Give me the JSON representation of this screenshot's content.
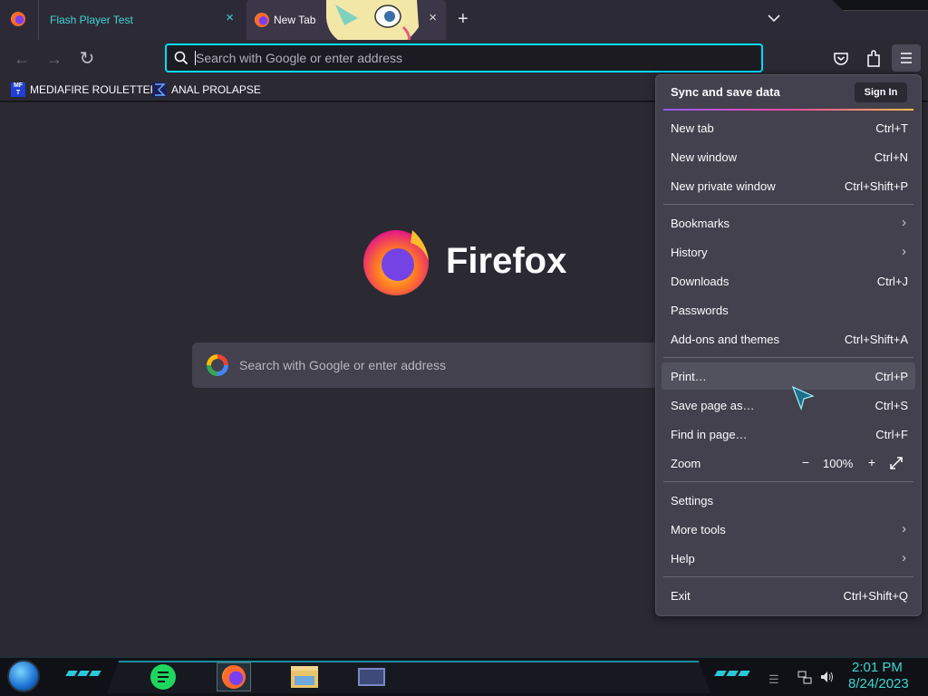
{
  "tabs": [
    {
      "label": "Flash Player Test",
      "close": "×",
      "active": false
    },
    {
      "label": "New Tab",
      "close": "×",
      "active": true
    }
  ],
  "tab_actions": {
    "new_tab": "+",
    "list_all": "chevron-down-icon"
  },
  "navbar": {
    "back": "←",
    "forward": "→",
    "reload": "↻",
    "url_placeholder": "Search with Google or enter address"
  },
  "bookmarks": [
    {
      "label": "MEDIAFIRE ROULETTER",
      "favicon": "MF T"
    },
    {
      "label": "ANAL PROLAPSE",
      "favicon": "sigma"
    }
  ],
  "newtab": {
    "brand": "Firefox",
    "search_placeholder": "Search with Google or enter address"
  },
  "menu": {
    "sync_title": "Sync and save data",
    "sign_in": "Sign In",
    "groups": [
      [
        {
          "label": "New tab",
          "shortcut": "Ctrl+T"
        },
        {
          "label": "New window",
          "shortcut": "Ctrl+N"
        },
        {
          "label": "New private window",
          "shortcut": "Ctrl+Shift+P"
        }
      ],
      [
        {
          "label": "Bookmarks",
          "submenu": true
        },
        {
          "label": "History",
          "submenu": true
        },
        {
          "label": "Downloads",
          "shortcut": "Ctrl+J"
        },
        {
          "label": "Passwords",
          "shortcut": ""
        },
        {
          "label": "Add-ons and themes",
          "shortcut": "Ctrl+Shift+A"
        }
      ],
      [
        {
          "label": "Print…",
          "shortcut": "Ctrl+P",
          "hover": true
        },
        {
          "label": "Save page as…",
          "shortcut": "Ctrl+S"
        },
        {
          "label": "Find in page…",
          "shortcut": "Ctrl+F"
        }
      ],
      [
        {
          "label": "Settings"
        },
        {
          "label": "More tools",
          "submenu": true
        },
        {
          "label": "Help",
          "submenu": true
        }
      ],
      [
        {
          "label": "Exit",
          "shortcut": "Ctrl+Shift+Q"
        }
      ]
    ],
    "zoom": {
      "label": "Zoom",
      "minus": "−",
      "value": "100%",
      "plus": "+",
      "fullscreen": "expand-icon"
    }
  },
  "taskbar": {
    "time": "2:01 PM",
    "date": "8/24/2023",
    "apps": [
      "spotify-icon",
      "firefox-icon",
      "file-explorer-icon",
      "control-panel-icon"
    ]
  },
  "colors": {
    "accent": "#00ddff",
    "tab_text": "#3fd6d0",
    "menu_bg": "#42414d",
    "page_bg": "#2b2a33"
  }
}
